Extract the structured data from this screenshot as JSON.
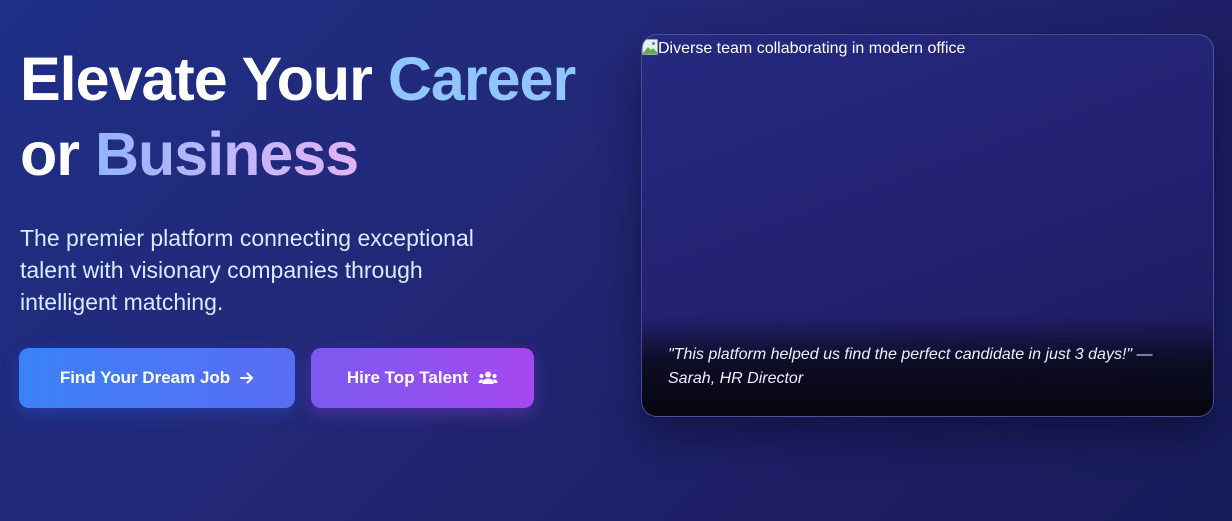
{
  "hero": {
    "headline_part1": "Elevate Your ",
    "headline_highlight1": "Career",
    "headline_part2": "or ",
    "headline_highlight2": "Business",
    "subtitle": "The premier platform connecting exceptional talent with visionary companies through intelligent matching."
  },
  "buttons": {
    "find_job_label": "Find Your Dream Job",
    "find_job_icon": "arrow-right-icon",
    "hire_label": "Hire Top Talent",
    "hire_icon": "users-icon"
  },
  "image_card": {
    "alt_text": "Diverse team collaborating in modern office",
    "quote": "\"This platform helped us find the perfect candidate in just 3 days!\" — Sarah, HR Director"
  },
  "colors": {
    "background": "#1f2670",
    "accent_blue": "#3b82f6",
    "accent_purple": "#a548f0",
    "highlight_career": "#93c5fd"
  }
}
